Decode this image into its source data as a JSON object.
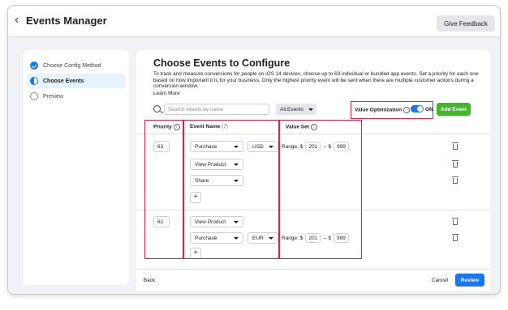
{
  "header": {
    "back_icon": "chevron-left-icon",
    "title": "Events Manager",
    "feedback_label": "Give Feedback"
  },
  "sidebar": {
    "steps": [
      {
        "label": "Choose Config Method",
        "state": "done"
      },
      {
        "label": "Choose Events",
        "state": "current"
      },
      {
        "label": "Preview",
        "state": "pending"
      }
    ]
  },
  "main": {
    "heading": "Choose Events to Configure",
    "description": "To track and measure conversions for people on iOS 14 devices, choose up to 63 individual or bundled app events. Set a priority for each one based on how important it is for your business. Only the highest priority event will be sent when there are multiple customer actions during a conversion window.",
    "learn_more": "Learn More",
    "search_placeholder": "Search events by name",
    "filter_label": "All Events",
    "value_optimization_label": "Value Optimization",
    "toggle_state": "ON",
    "add_event_label": "Add Event",
    "columns": {
      "priority": "Priority",
      "event_name": "Event Name",
      "event_count": "(7)",
      "value_set": "Value Set"
    }
  },
  "groups": [
    {
      "priority": "63",
      "events": [
        {
          "name": "Purchase",
          "currency": "USD",
          "range_label": "Range: $",
          "min": "201",
          "sep": "-- $",
          "max": "999"
        },
        {
          "name": "View Product"
        },
        {
          "name": "Share"
        }
      ]
    },
    {
      "priority": "62",
      "events": [
        {
          "name": "View Product"
        },
        {
          "name": "Purchase",
          "currency": "EUR",
          "range_label": "Range: $",
          "min": "201",
          "sep": "-- $",
          "max": "999"
        }
      ]
    }
  ],
  "footer": {
    "back_label": "Back",
    "cancel_label": "Cancel",
    "review_label": "Review"
  },
  "colors": {
    "accent": "#1877f2",
    "add_green": "#42b72a",
    "highlight_red": "#e41e3f"
  }
}
